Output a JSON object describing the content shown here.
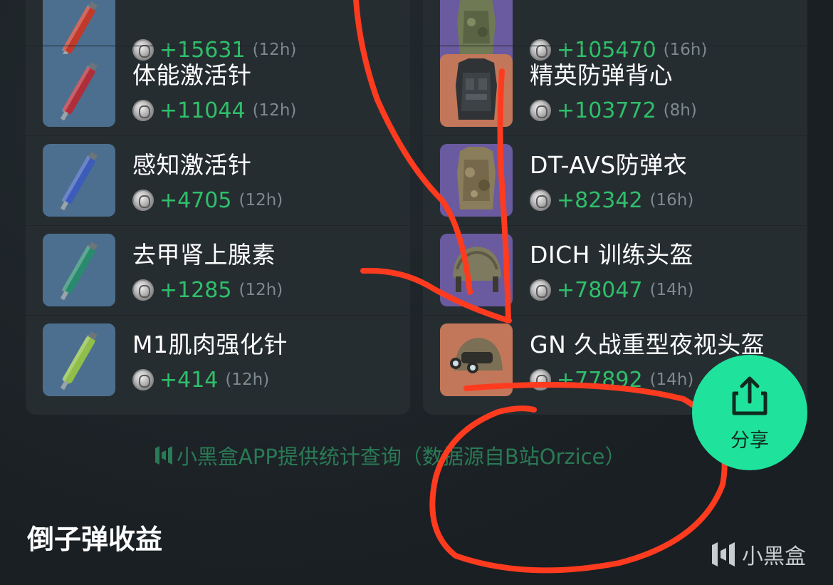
{
  "left_items": [
    {
      "name": "",
      "value": "+15631",
      "duration": "(12h)",
      "color": "blue",
      "syringe": "#c0392b"
    },
    {
      "name": "体能激活针",
      "value": "+11044",
      "duration": "(12h)",
      "color": "blue",
      "syringe": "#b02d3a"
    },
    {
      "name": "感知激活针",
      "value": "+4705",
      "duration": "(12h)",
      "color": "blue",
      "syringe": "#3b5cb8"
    },
    {
      "name": "去甲肾上腺素",
      "value": "+1285",
      "duration": "(12h)",
      "color": "blue",
      "syringe": "#2a8a6e"
    },
    {
      "name": "M1肌肉强化针",
      "value": "+414",
      "duration": "(12h)",
      "color": "blue",
      "syringe": "#8fbf4a"
    }
  ],
  "right_items": [
    {
      "name": "",
      "value": "+105470",
      "duration": "(16h)",
      "color": "purple",
      "gear": "vest-camo"
    },
    {
      "name": "精英防弹背心",
      "value": "+103772",
      "duration": "(8h)",
      "color": "orange",
      "gear": "vest-dark"
    },
    {
      "name": "DT-AVS防弹衣",
      "value": "+82342",
      "duration": "(16h)",
      "color": "purple",
      "gear": "vest-camo"
    },
    {
      "name": "DICH 训练头盔",
      "value": "+78047",
      "duration": "(14h)",
      "color": "purple",
      "gear": "helmet"
    },
    {
      "name": "GN 久战重型夜视头盔",
      "value": "+77892",
      "duration": "(14h)",
      "color": "orange",
      "gear": "nv-helmet"
    }
  ],
  "footer": {
    "note": "小黑盒APP提供统计查询（数据源自B站Orzice）"
  },
  "section": {
    "title": "倒子弹收益"
  },
  "share": {
    "label": "分享"
  },
  "watermark": {
    "text": "小黑盒"
  },
  "colors": {
    "accent_green": "#1fe39d",
    "value_green": "#2fbf6a",
    "annotation_red": "#ff3b1f"
  }
}
